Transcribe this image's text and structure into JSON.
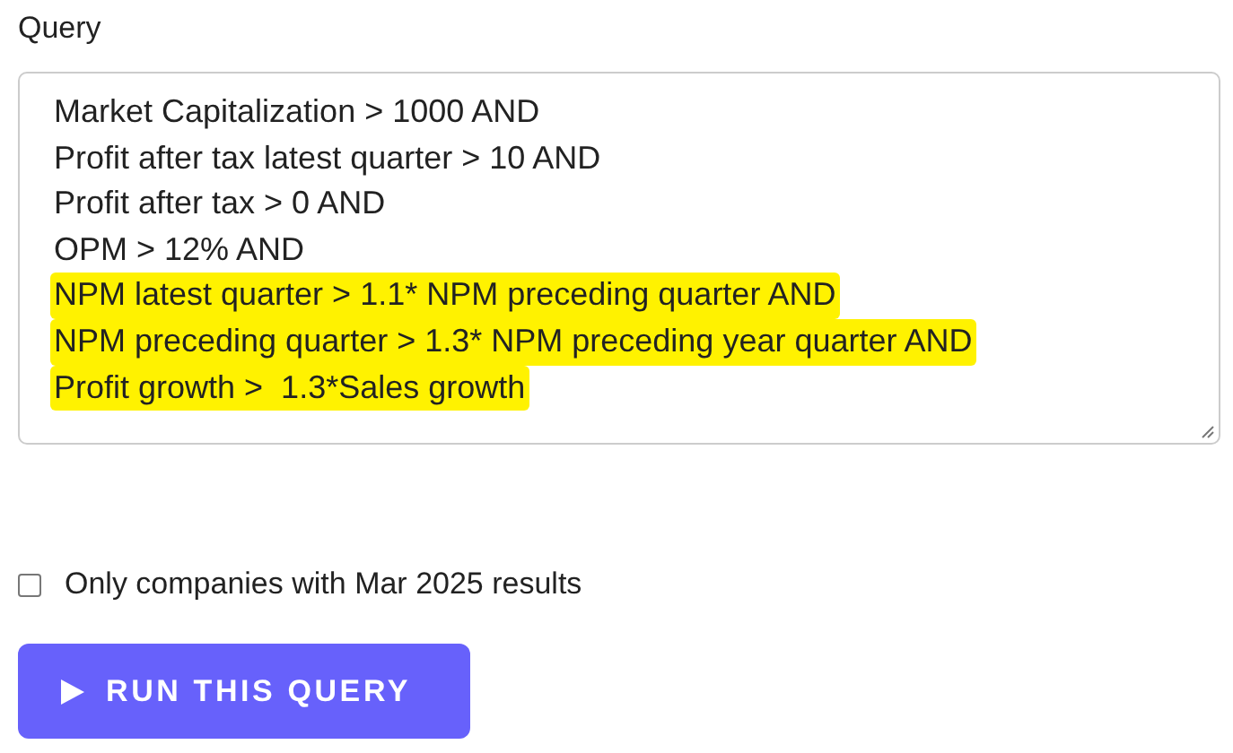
{
  "query": {
    "label": "Query",
    "lines": [
      {
        "text": "Market Capitalization > 1000 AND",
        "highlighted": false
      },
      {
        "text": "Profit after tax latest quarter > 10 AND",
        "highlighted": false
      },
      {
        "text": "Profit after tax > 0 AND",
        "highlighted": false
      },
      {
        "text": "OPM > 12% AND",
        "highlighted": false
      },
      {
        "text": "NPM latest quarter > 1.1* NPM preceding quarter AND",
        "highlighted": true
      },
      {
        "text": "NPM preceding quarter > 1.3* NPM preceding year quarter AND",
        "highlighted": true
      },
      {
        "text": "Profit growth >  1.3*Sales growth",
        "highlighted": true
      }
    ]
  },
  "filter": {
    "label": "Only companies with Mar 2025 results",
    "checked": false
  },
  "button": {
    "label": "RUN THIS QUERY"
  }
}
